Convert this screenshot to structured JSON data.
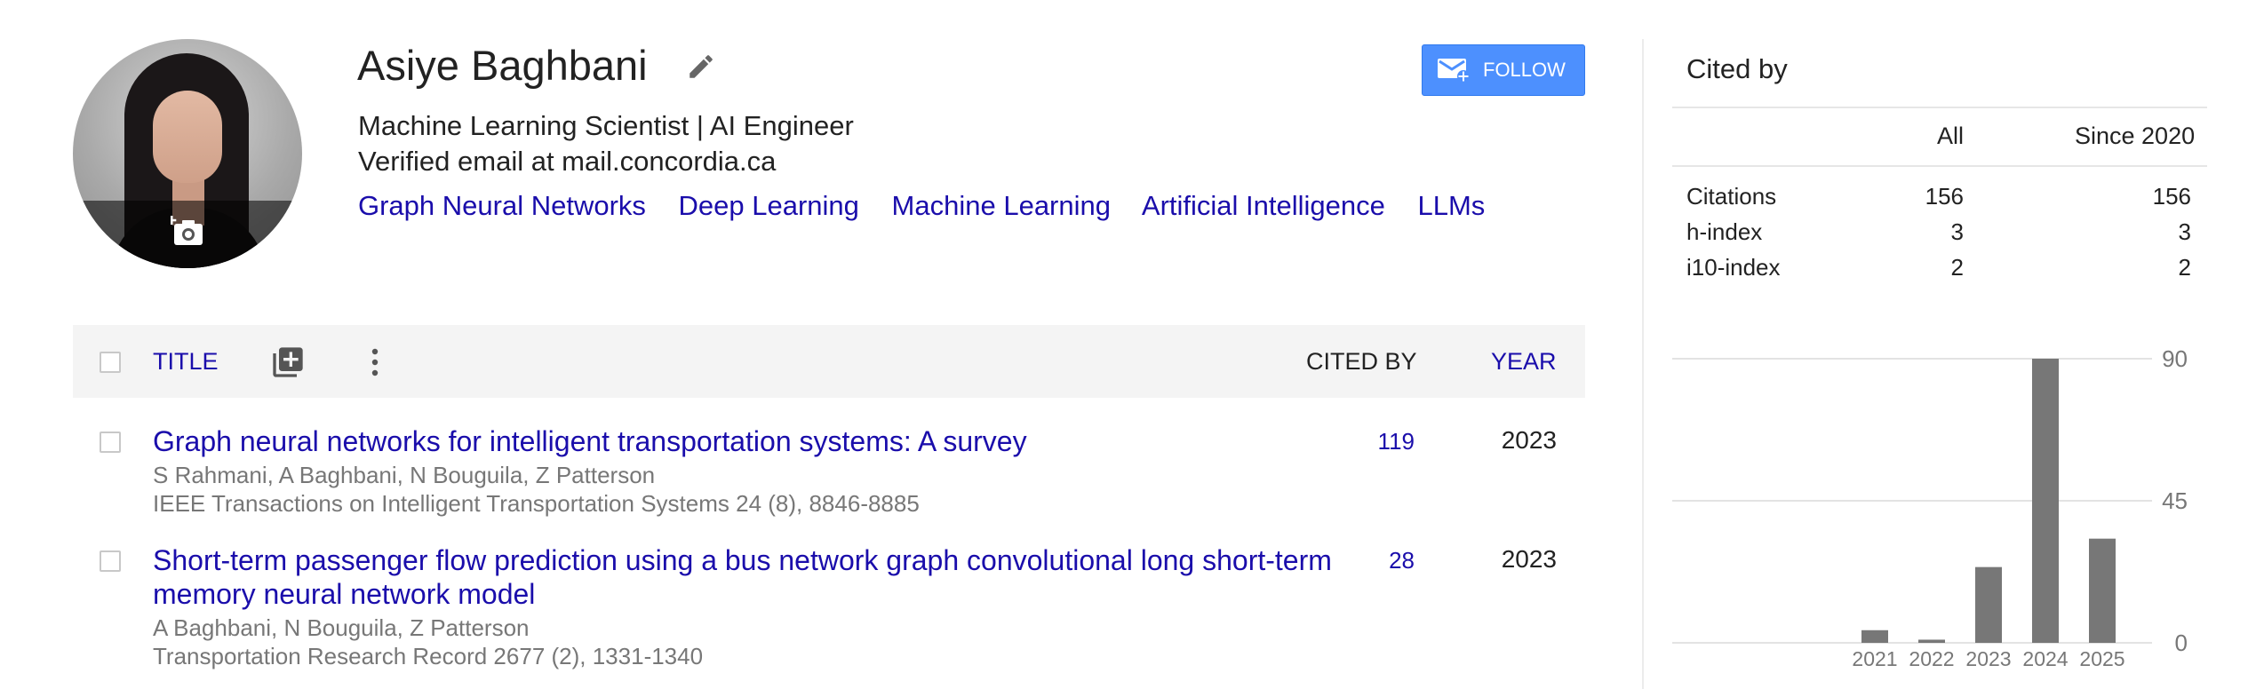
{
  "profile": {
    "name": "Asiye Baghbani",
    "affiliation": "Machine Learning Scientist | AI Engineer",
    "email": "Verified email at mail.concordia.ca",
    "interests": [
      "Graph Neural Networks",
      "Deep Learning",
      "Machine Learning",
      "Artificial Intelligence",
      "LLMs"
    ],
    "follow_label": "FOLLOW"
  },
  "table": {
    "header_title": "TITLE",
    "header_cited_by": "CITED BY",
    "header_year": "YEAR",
    "articles": [
      {
        "title": "Graph neural networks for intelligent transportation systems: A survey",
        "authors": "S Rahmani, A Baghbani, N Bouguila, Z Patterson",
        "venue": "IEEE Transactions on Intelligent Transportation Systems 24 (8), 8846-8885",
        "cited_by": "119",
        "year": "2023"
      },
      {
        "title": "Short-term passenger flow prediction using a bus network graph convolutional long short-term memory neural network model",
        "authors": "A Baghbani, N Bouguila, Z Patterson",
        "venue": "Transportation Research Record 2677 (2), 1331-1340",
        "cited_by": "28",
        "year": "2023"
      }
    ]
  },
  "cited_by": {
    "title": "Cited by",
    "col_all": "All",
    "col_since": "Since 2020",
    "rows": [
      {
        "label": "Citations",
        "all": "156",
        "since": "156"
      },
      {
        "label": "h-index",
        "all": "3",
        "since": "3"
      },
      {
        "label": "i10-index",
        "all": "2",
        "since": "2"
      }
    ]
  },
  "colors": {
    "link": "#1a0dab",
    "follow_button": "#4d90fe",
    "bar": "#777777"
  },
  "chart_data": {
    "type": "bar",
    "categories": [
      "2021",
      "2022",
      "2023",
      "2024",
      "2025"
    ],
    "values": [
      4,
      1,
      24,
      90,
      33
    ],
    "yticks": [
      0,
      45,
      90
    ],
    "ylim": [
      0,
      90
    ],
    "grid": true,
    "title": "",
    "xlabel": "",
    "ylabel": ""
  }
}
